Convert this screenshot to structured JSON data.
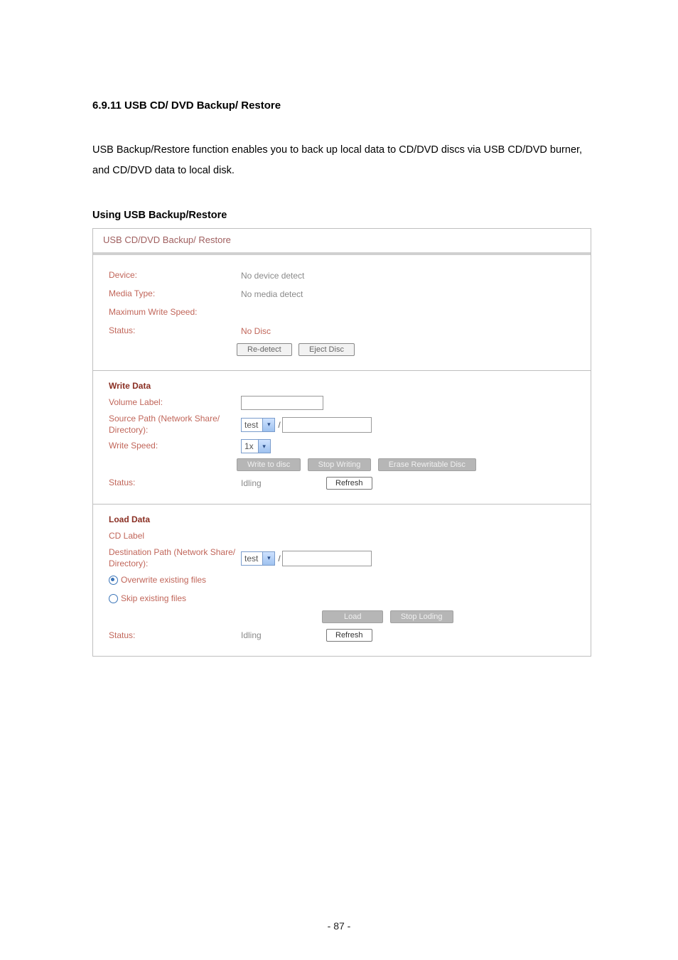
{
  "pageNumber": "- 87 -",
  "heading": "6.9.11  USB CD/ DVD Backup/ Restore",
  "intro": "USB Backup/Restore function enables you to back up local data to CD/DVD discs via USB CD/DVD burner, and CD/DVD data to local disk.",
  "subhead": "Using USB Backup/Restore",
  "panel": {
    "title": "USB CD/DVD Backup/ Restore",
    "info": {
      "deviceLabel": "Device:",
      "deviceValue": "No device detect",
      "mediaLabel": "Media Type:",
      "mediaValue": "No media detect",
      "maxSpeedLabel": "Maximum Write Speed:",
      "maxSpeedValue": "",
      "statusLabel": "Status:",
      "statusValue": "No Disc",
      "btnRedetect": "Re-detect",
      "btnEject": "Eject Disc"
    },
    "write": {
      "heading": "Write Data",
      "volumeLabel": "Volume Label:",
      "volumeValue": "",
      "sourceLabel": "Source Path (Network Share/ Directory):",
      "sourceShare": "test",
      "sourcePath": "",
      "slash": "/",
      "speedLabel": "Write Speed:",
      "speedValue": "1x",
      "btnWrite": "Write to disc",
      "btnStop": "Stop Writing",
      "btnErase": "Erase Rewritable Disc",
      "statusLabel": "Status:",
      "statusValue": "Idling",
      "btnRefresh": "Refresh"
    },
    "load": {
      "heading": "Load Data",
      "cdLabel": "CD Label",
      "destLabel": "Destination Path (Network Share/ Directory):",
      "destShare": "test",
      "destPath": "",
      "slash": "/",
      "optOverwrite": "Overwrite existing files",
      "optSkip": "Skip existing files",
      "btnLoad": "Load",
      "btnStop": "Stop Loding",
      "statusLabel": "Status:",
      "statusValue": "Idling",
      "btnRefresh": "Refresh"
    }
  }
}
